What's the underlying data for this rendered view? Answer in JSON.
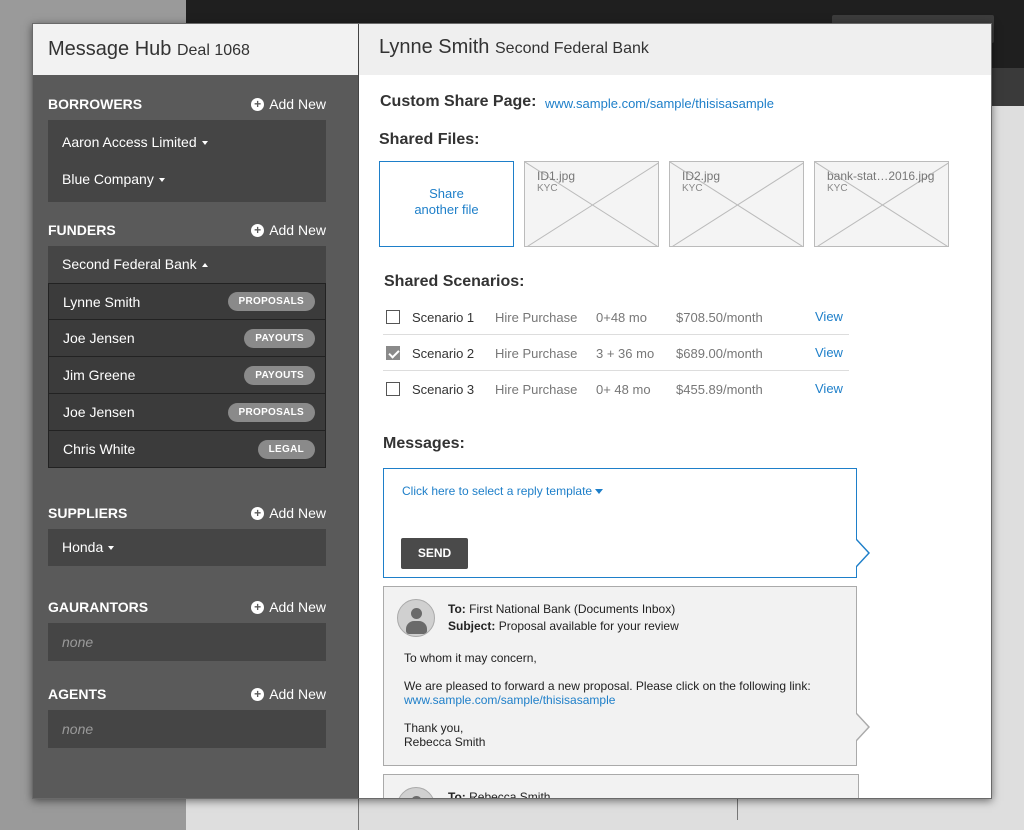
{
  "app": {
    "title": "Message Hub",
    "deal": "Deal 1068"
  },
  "sidebar": {
    "add_new": "Add New",
    "borrowers": {
      "title": "BORROWERS",
      "items": [
        "Aaron Access Limited",
        "Blue Company"
      ]
    },
    "funders": {
      "title": "FUNDERS",
      "selected": "Second Federal Bank",
      "people": [
        {
          "name": "Lynne Smith",
          "tag": "PROPOSALS"
        },
        {
          "name": "Joe Jensen",
          "tag": "PAYOUTS"
        },
        {
          "name": "Jim Greene",
          "tag": "PAYOUTS"
        },
        {
          "name": "Joe Jensen",
          "tag": "PROPOSALS"
        },
        {
          "name": "Chris White",
          "tag": "LEGAL"
        }
      ]
    },
    "suppliers": {
      "title": "SUPPLIERS",
      "items": [
        "Honda"
      ]
    },
    "guarantors": {
      "title": "GAURANTORS",
      "empty": "none"
    },
    "agents": {
      "title": "AGENTS",
      "empty": "none"
    }
  },
  "contact": {
    "name": "Lynne Smith",
    "org": "Second Federal Bank"
  },
  "share_page": {
    "label": "Custom Share Page:",
    "url": "www.sample.com/sample/thisisasample"
  },
  "shared_files": {
    "label": "Shared Files:",
    "share_button": [
      "Share",
      "another file"
    ],
    "files": [
      {
        "name": "ID1.jpg",
        "type": "KYC"
      },
      {
        "name": "ID2.jpg",
        "type": "KYC"
      },
      {
        "name": "bank-stat…2016.jpg",
        "type": "KYC"
      }
    ]
  },
  "scenarios": {
    "label": "Shared Scenarios:",
    "view_label": "View",
    "rows": [
      {
        "name": "Scenario 1",
        "type": "Hire Purchase",
        "term": "0+48 mo",
        "price": "$708.50/month",
        "checked": false
      },
      {
        "name": "Scenario 2",
        "type": "Hire Purchase",
        "term": "3 + 36 mo",
        "price": "$689.00/month",
        "checked": true
      },
      {
        "name": "Scenario 3",
        "type": "Hire Purchase",
        "term": "0+ 48 mo",
        "price": "$455.89/month",
        "checked": false
      }
    ]
  },
  "messages": {
    "label": "Messages:",
    "template_prompt": "Click here to select a reply template",
    "send_label": "SEND",
    "to_label": "To:",
    "subject_label": "Subject:",
    "items": [
      {
        "to": "First National Bank (Documents Inbox)",
        "subject": "Proposal available for your review",
        "greeting": "To whom it may concern,",
        "body": "We are pleased to forward a new proposal. Please click on the following link:",
        "link": "www.sample.com/sample/thisisasample",
        "signoff": "Thank you,",
        "signature": "Rebecca Smith"
      },
      {
        "to": "Rebecca Smith"
      }
    ]
  },
  "colors": {
    "accent": "#1e7fc9",
    "sidebar": "#5a5a5a",
    "sidebar_dark": "#3b3b3b"
  }
}
